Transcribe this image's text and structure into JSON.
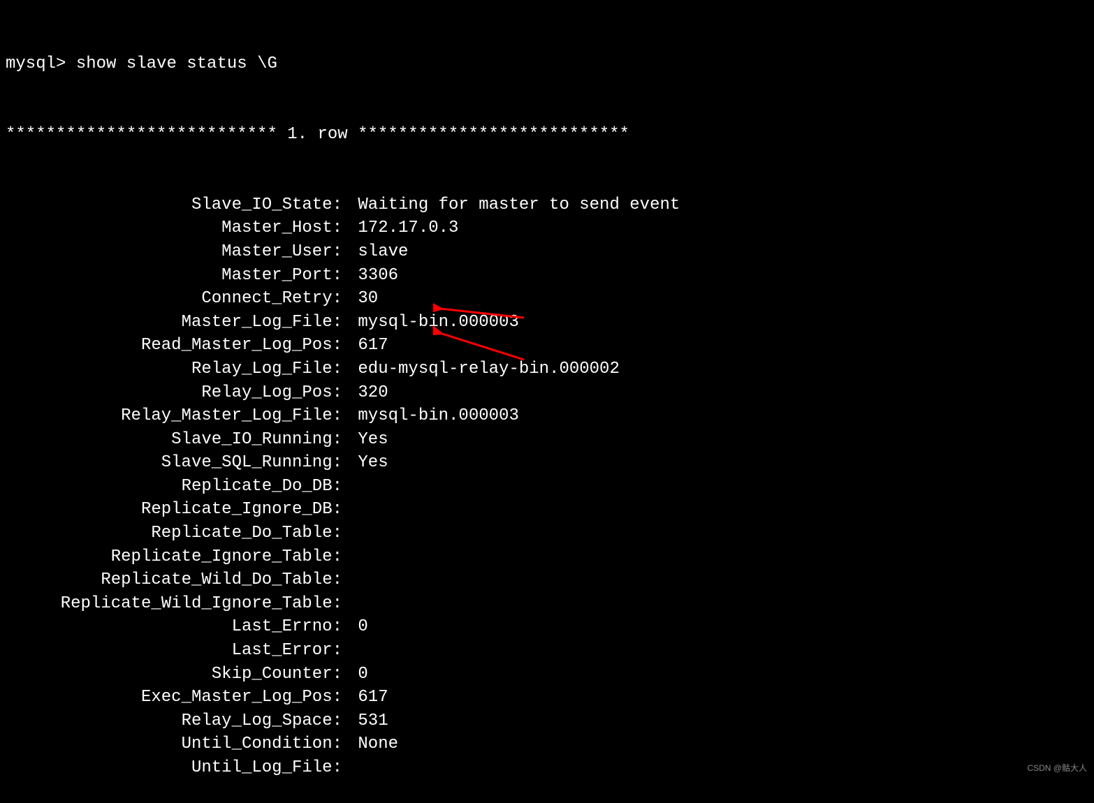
{
  "prompt": "mysql> ",
  "command": "show slave status \\G",
  "row_header": "*************************** 1. row ***************************",
  "status": [
    {
      "label": "Slave_IO_State:",
      "value": "Waiting for master to send event"
    },
    {
      "label": "Master_Host:",
      "value": "172.17.0.3"
    },
    {
      "label": "Master_User:",
      "value": "slave"
    },
    {
      "label": "Master_Port:",
      "value": "3306"
    },
    {
      "label": "Connect_Retry:",
      "value": "30"
    },
    {
      "label": "Master_Log_File:",
      "value": "mysql-bin.000003"
    },
    {
      "label": "Read_Master_Log_Pos:",
      "value": "617"
    },
    {
      "label": "Relay_Log_File:",
      "value": "edu-mysql-relay-bin.000002"
    },
    {
      "label": "Relay_Log_Pos:",
      "value": "320"
    },
    {
      "label": "Relay_Master_Log_File:",
      "value": "mysql-bin.000003"
    },
    {
      "label": "Slave_IO_Running:",
      "value": "Yes"
    },
    {
      "label": "Slave_SQL_Running:",
      "value": "Yes"
    },
    {
      "label": "Replicate_Do_DB:",
      "value": ""
    },
    {
      "label": "Replicate_Ignore_DB:",
      "value": ""
    },
    {
      "label": "Replicate_Do_Table:",
      "value": ""
    },
    {
      "label": "Replicate_Ignore_Table:",
      "value": ""
    },
    {
      "label": "Replicate_Wild_Do_Table:",
      "value": ""
    },
    {
      "label": "Replicate_Wild_Ignore_Table:",
      "value": ""
    },
    {
      "label": "Last_Errno:",
      "value": "0"
    },
    {
      "label": "Last_Error:",
      "value": ""
    },
    {
      "label": "Skip_Counter:",
      "value": "0"
    },
    {
      "label": "Exec_Master_Log_Pos:",
      "value": "617"
    },
    {
      "label": "Relay_Log_Space:",
      "value": "531"
    },
    {
      "label": "Until_Condition:",
      "value": "None"
    },
    {
      "label": "Until_Log_File:",
      "value": ""
    }
  ],
  "watermark": "CSDN @骷大人",
  "arrow_color": "#ff0000"
}
